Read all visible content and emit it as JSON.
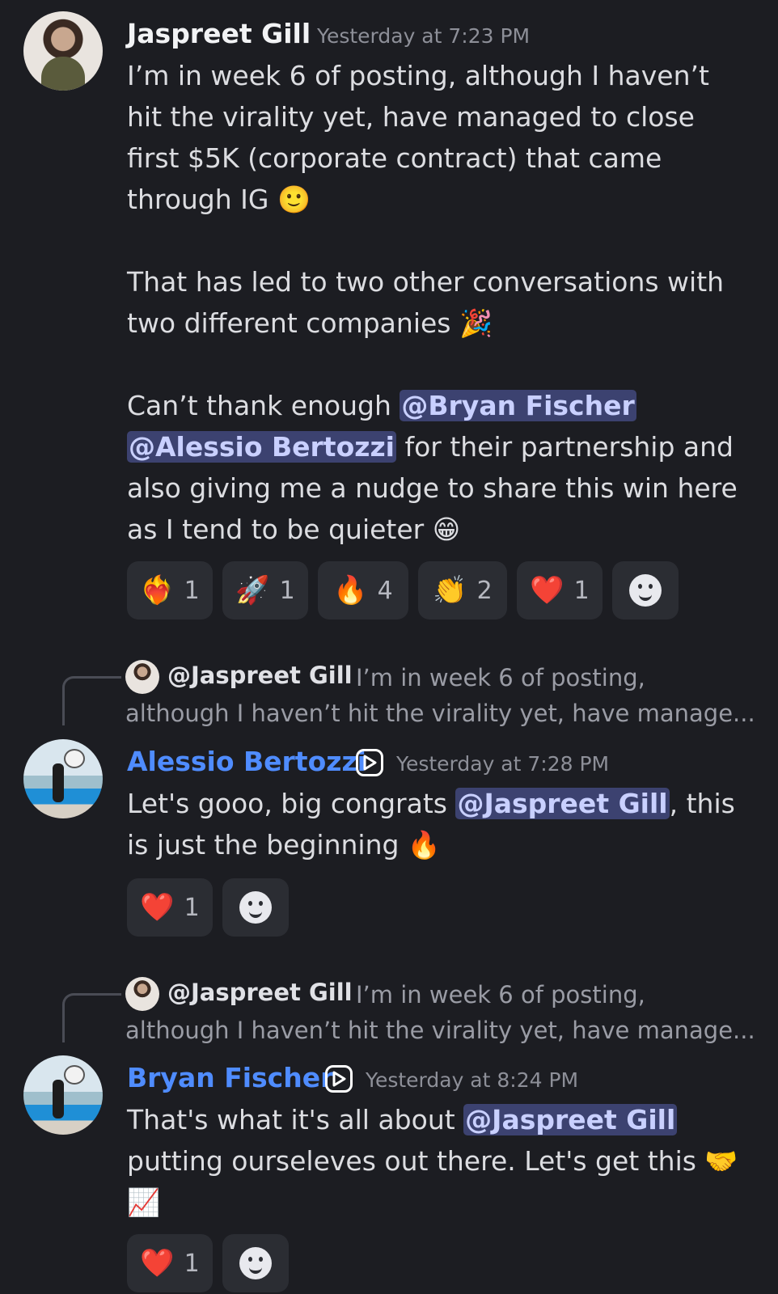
{
  "messages": [
    {
      "author": "Jaspreet Gill",
      "timestamp": "Yesterday at 7:23 PM",
      "text_a": "I’m in week 6 of posting, although I haven’t hit the virality yet, have managed to close first $5K (corporate contract) that came through IG 🙂\n\nThat has led to two other conversations with two different companies 🎉\n\nCan’t thank enough ",
      "mention_1": "@Bryan Fischer",
      "text_b": " ",
      "mention_2": "@Alessio Bertozzi",
      "text_c": " for their partnership and also giving me a nudge to share this win here as I tend to be quieter 😁",
      "reactions": [
        {
          "emoji": "❤️‍🔥",
          "count": "1"
        },
        {
          "emoji": "🚀",
          "count": "1"
        },
        {
          "emoji": "🔥",
          "count": "4"
        },
        {
          "emoji": "👏",
          "count": "2"
        },
        {
          "emoji": "❤️",
          "count": "1"
        }
      ]
    },
    {
      "reply_to_name": "@Jaspreet Gill",
      "reply_preview_1": "I’m in week 6 of posting,",
      "reply_preview_2": "although I haven’t hit the virality yet, have manage...",
      "author": "Alessio Bertozzi",
      "timestamp": "Yesterday at 7:28 PM",
      "text_a": "Let's gooo, big congrats ",
      "mention_1": "@Jaspreet Gill",
      "text_b": ", this is just the beginning 🔥",
      "reactions": [
        {
          "emoji": "❤️",
          "count": "1"
        }
      ]
    },
    {
      "reply_to_name": "@Jaspreet Gill",
      "reply_preview_1": "I’m in week 6 of posting,",
      "reply_preview_2": "although I haven’t hit the virality yet, have manage...",
      "author": "Bryan Fischer",
      "timestamp": "Yesterday at 8:24 PM",
      "text_a": "That's what it's all about ",
      "mention_1": "@Jaspreet Gill",
      "text_b": " putting ourseleves out there. Let's get this 🤝 📈",
      "reactions": [
        {
          "emoji": "❤️",
          "count": "1"
        }
      ]
    }
  ],
  "colors": {
    "background": "#1c1d22",
    "mention_bg": "#3c4270",
    "author_accent": "#4f8cff"
  },
  "icons": [
    "add-reaction-icon",
    "play-badge-icon"
  ]
}
